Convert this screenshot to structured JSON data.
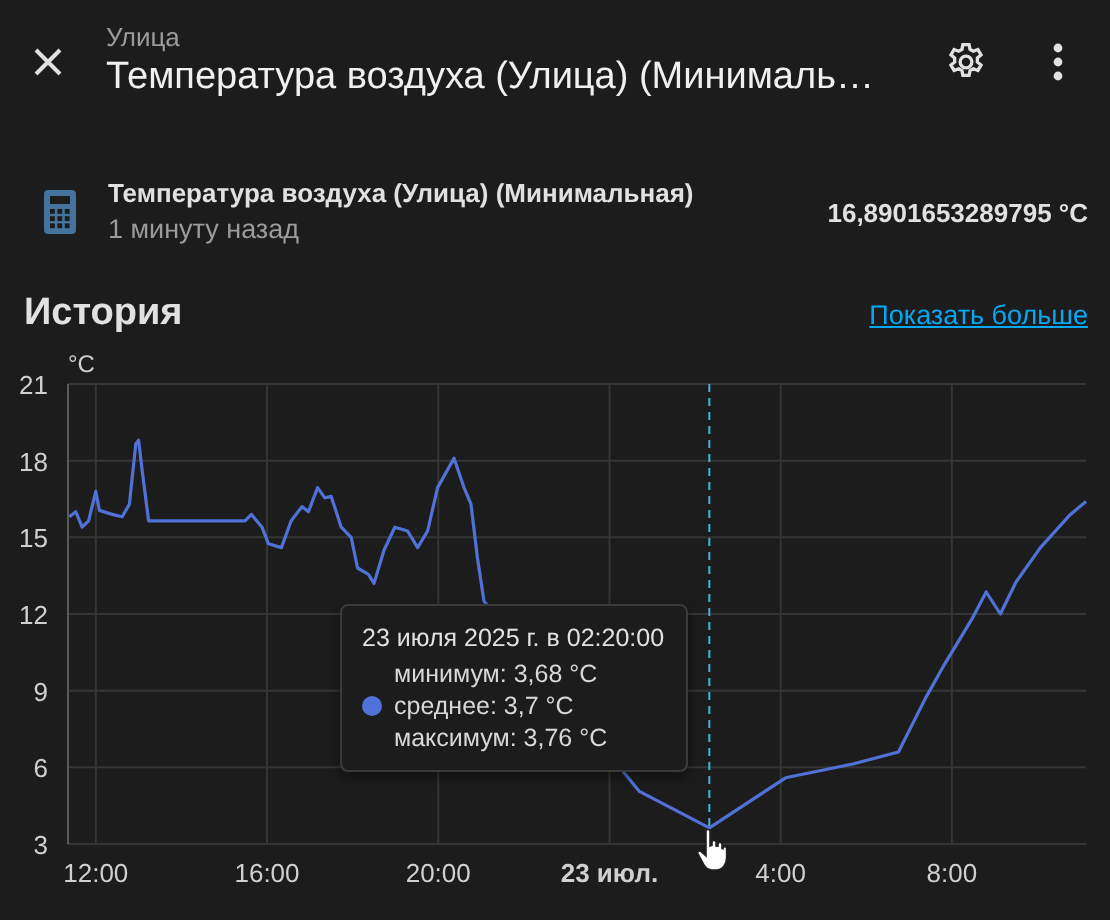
{
  "header": {
    "area": "Улица",
    "title": "Температура воздуха (Улица) (Минималь…"
  },
  "entity": {
    "name": "Температура воздуха (Улица) (Минимальная)",
    "updated": "1 минуту назад",
    "value": "16,8901653289795 °C"
  },
  "history": {
    "title": "История",
    "more_link": "Показать больше",
    "chart_data": {
      "type": "line",
      "ylabel": "°C",
      "grid": true,
      "xlim": [
        "2025-07-22T11:21",
        "2025-07-23T11:08"
      ],
      "ylim": [
        3,
        21
      ],
      "xticks": [
        {
          "value": "2025-07-22T12:00",
          "label": "12:00"
        },
        {
          "value": "2025-07-22T16:00",
          "label": "16:00"
        },
        {
          "value": "2025-07-22T20:00",
          "label": "20:00"
        },
        {
          "value": "2025-07-23T00:00",
          "label": "23 июл."
        },
        {
          "value": "2025-07-23T04:00",
          "label": "4:00"
        },
        {
          "value": "2025-07-23T08:00",
          "label": "8:00"
        }
      ],
      "yticks": [
        3,
        6,
        9,
        12,
        15,
        18,
        21
      ],
      "x": [
        "2025-07-22T11:23",
        "2025-07-22T11:32",
        "2025-07-22T11:41",
        "2025-07-22T11:50",
        "2025-07-22T12:00",
        "2025-07-22T12:05",
        "2025-07-22T12:23",
        "2025-07-22T12:37",
        "2025-07-22T12:47",
        "2025-07-22T12:56",
        "2025-07-22T13:00",
        "2025-07-22T13:05",
        "2025-07-22T13:14",
        "2025-07-22T15:29",
        "2025-07-22T15:38",
        "2025-07-22T15:53",
        "2025-07-22T16:02",
        "2025-07-22T16:20",
        "2025-07-22T16:34",
        "2025-07-22T16:49",
        "2025-07-22T16:58",
        "2025-07-22T17:11",
        "2025-07-22T17:21",
        "2025-07-22T17:30",
        "2025-07-22T17:44",
        "2025-07-22T17:58",
        "2025-07-22T18:07",
        "2025-07-22T18:22",
        "2025-07-22T18:30",
        "2025-07-22T18:44",
        "2025-07-22T18:59",
        "2025-07-22T19:17",
        "2025-07-22T19:31",
        "2025-07-22T19:45",
        "2025-07-22T19:59",
        "2025-07-22T20:22",
        "2025-07-22T20:36",
        "2025-07-22T20:46",
        "2025-07-22T20:55",
        "2025-07-22T21:04",
        "2025-07-23T00:42",
        "2025-07-23T02:20",
        "2025-07-23T04:07",
        "2025-07-23T05:41",
        "2025-07-23T06:45",
        "2025-07-23T07:23",
        "2025-07-23T07:50",
        "2025-07-23T08:29",
        "2025-07-23T08:48",
        "2025-07-23T09:08",
        "2025-07-23T09:30",
        "2025-07-23T10:04",
        "2025-07-23T10:46",
        "2025-07-23T11:08"
      ],
      "series": [
        {
          "color": "#5072d8",
          "values": [
            15.8,
            16.0,
            15.4,
            15.65,
            16.8,
            16.05,
            15.9,
            15.8,
            16.3,
            18.65,
            18.8,
            17.6,
            15.65,
            15.65,
            15.9,
            15.4,
            14.75,
            14.6,
            15.65,
            16.2,
            16.0,
            16.95,
            16.55,
            16.6,
            15.4,
            15.0,
            13.8,
            13.55,
            13.2,
            14.5,
            15.4,
            15.25,
            14.6,
            15.25,
            16.95,
            18.1,
            16.95,
            16.3,
            14.2,
            12.5,
            5.06,
            3.63,
            5.59,
            6.13,
            6.6,
            8.7,
            10.05,
            11.85,
            12.86,
            12.0,
            13.25,
            14.6,
            15.9,
            16.4
          ]
        }
      ],
      "ref_lines": [
        {
          "axis": "x",
          "value": "2025-07-23T02:20",
          "color": "#3fb6d8"
        }
      ]
    },
    "tooltip": {
      "title": "23 июля 2025 г. в 02:20:00",
      "lines": [
        {
          "text": "минимум: 3,68 °C",
          "marker": false
        },
        {
          "text": "среднее: 3,7 °C",
          "marker": true
        },
        {
          "text": "максимум: 3,76 °C",
          "marker": false
        }
      ]
    }
  }
}
